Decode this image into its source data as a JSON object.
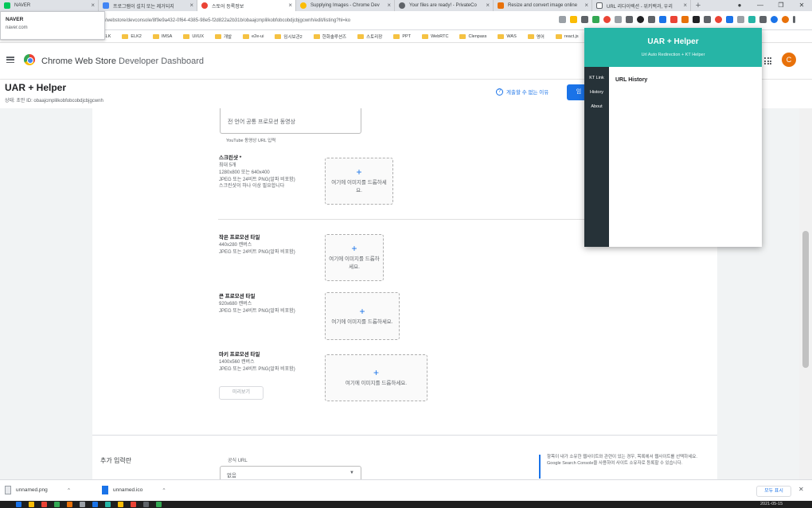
{
  "tabs": [
    {
      "label": "NAVER",
      "color": "#03c75a",
      "active": false
    },
    {
      "label": "프로그램이 설치 또는 제거되지",
      "color": "#4285f4",
      "active": false
    },
    {
      "label": "스토어 등록정보",
      "color": "#ea4335",
      "active": true
    },
    {
      "label": "Supplying Images - Chrome Dev",
      "color": "#fbbc05",
      "active": false
    },
    {
      "label": "Your files are ready! - PrivateCo",
      "color": "#5f6368",
      "active": false
    },
    {
      "label": "Resize and convert image online",
      "color": "#e8710a",
      "active": false
    },
    {
      "label": "URL 리다이렉션 - 위키백과, 우리",
      "color": "#5f6368",
      "active": false
    }
  ],
  "tooltip": {
    "title": "NAVER",
    "url": "naver.com"
  },
  "address": {
    "url": "/webstore/devconsole/8f9e9a432-0f64-4385-98e5-f2d822a2b31b/obaajcmplilkobfobcobdjcbjgcwnh/edit/listing?hl=ko"
  },
  "bookmarks": [
    "ELK",
    "ELK2",
    "IMSA",
    "UI/UX",
    "개발",
    "e2e-ui",
    "임시보관2",
    "한화솔루션즈",
    "스토리장",
    "PPT",
    "WebRTC",
    "Clenpass",
    "WAS",
    "영어",
    "react.js"
  ],
  "header": {
    "title": "Chrome Web Store",
    "subtitle": "Developer Dashboard",
    "avatar": "C"
  },
  "item": {
    "title": "UAR + Helper",
    "status": "상태: 초안   ID: obaajcmplilkobfobcobdjcbjgcwnh",
    "help_link": "게출할 수 없는 이유",
    "submit_label": "임"
  },
  "video": {
    "placeholder": "전 언어 공통 프로모션 동영상",
    "hint": "YouTube 동영상 URL 입력"
  },
  "assets": {
    "screenshot": {
      "name": "스크린샷 *",
      "l1": "최대 5개",
      "l2": "1280x800 또는 640x400",
      "l3": "JPEG 또는 24비트 PNG(알파 비포함)",
      "l4": "스크린샷이 하나 이상 필요합니다",
      "drop": "여기에 이미지를 드롭하세요."
    },
    "small_tile": {
      "name": "작은 프로모션 타일",
      "l1": "440x280 캔버스",
      "l2": "JPEG 또는 24비트 PNG(알파 비포함)",
      "drop": "여기에 이미지를 드롭하세요."
    },
    "large_tile": {
      "name": "큰 프로모션 타일",
      "l1": "920x680 캔버스",
      "l2": "JPEG 또는 24비트 PNG(알파 비포함)",
      "drop": "여기에 이미지를 드롭하세요."
    },
    "marquee": {
      "name": "마키 프로모션 타일",
      "l1": "1400x560 캔버스",
      "l2": "JPEG 또는 24비트 PNG(알파 비포함)",
      "drop": "여기에 이미지를 드롭하세요."
    }
  },
  "preview_label": "미리보기",
  "extra": {
    "title": "추가 입력란",
    "official_url_label": "공식 URL",
    "official_url_value": "없음",
    "help": "항목이 내가 소유한 웹사이트와 관련이 있는 경우, 목록에서 웹사이트를 선택하세요. Google Search Console을 사용하여 사이트 소유자로 등록할 수 있습니다."
  },
  "popup": {
    "title": "UAR + Helper",
    "subtitle": "Url Auto Redirection + KT Helper",
    "nav": [
      "KT Link",
      "History",
      "About"
    ],
    "section": "URL History"
  },
  "downloads": [
    {
      "name": "unnamed.png"
    },
    {
      "name": "unnamed.ico"
    }
  ],
  "show_all": "모두 표시",
  "clock": "2021-05-15",
  "colors": {
    "accent": "#1a73e8",
    "popup_header": "#26b5a6",
    "popup_sidebar": "#263238"
  }
}
